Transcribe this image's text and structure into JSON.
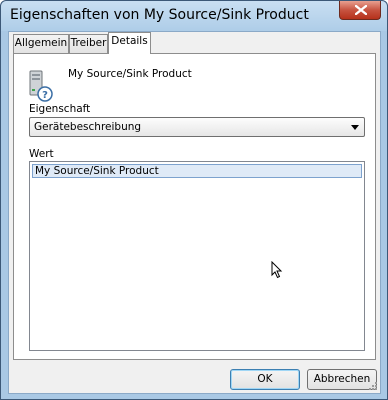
{
  "window": {
    "title": "Eigenschaften von My Source/Sink Product"
  },
  "tabs": [
    {
      "label": "Allgemein",
      "active": false
    },
    {
      "label": "Treiber",
      "active": false
    },
    {
      "label": "Details",
      "active": true
    }
  ],
  "device": {
    "name": "My Source/Sink Product",
    "icon": "generic-device-icon"
  },
  "property": {
    "label": "Eigenschaft",
    "selected": "Gerätebeschreibung"
  },
  "value": {
    "label": "Wert",
    "items": [
      "My Source/Sink Product"
    ]
  },
  "buttons": {
    "ok": "OK",
    "cancel": "Abbrechen"
  },
  "colors": {
    "title_bar": "#aecde8",
    "close_button": "#c75441",
    "selection": "#dfeaf7"
  }
}
